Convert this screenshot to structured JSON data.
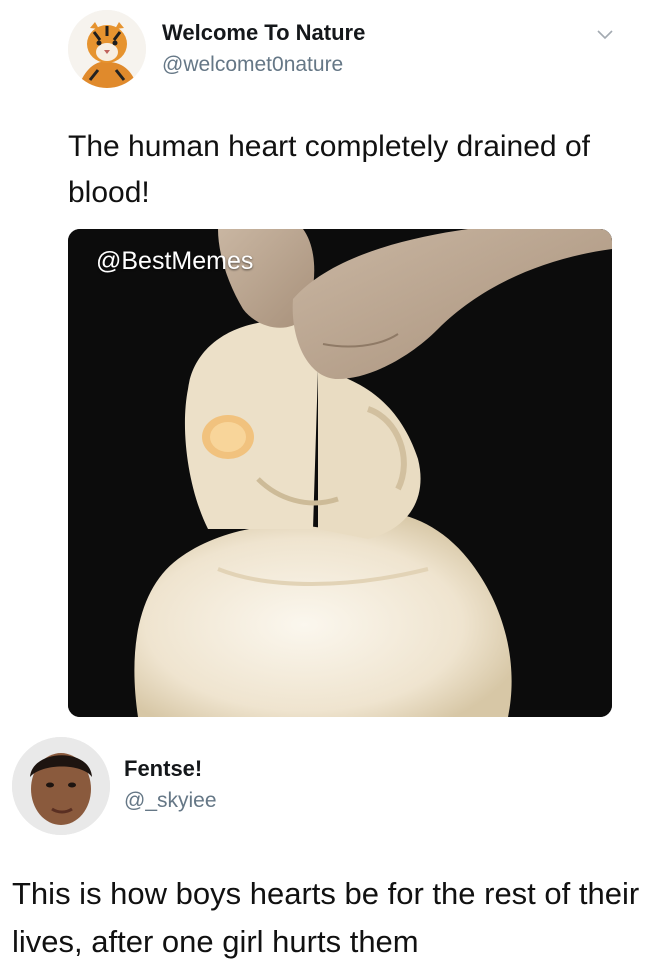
{
  "tweet1": {
    "display_name": "Welcome To Nature",
    "handle": "@welcomet0nature",
    "text": "The human heart completely drained of blood!",
    "avatar_icon": "tiger-avatar",
    "menu_icon": "chevron-down-icon",
    "image": {
      "watermark": "@BestMemes",
      "subject": "pale heart held by gloved fingers on black background"
    }
  },
  "tweet2": {
    "display_name": "Fentse!",
    "handle": "@_skyiee",
    "text": "This is how boys hearts be for the rest of their lives, after one girl hurts them",
    "avatar_icon": "person-avatar"
  },
  "colors": {
    "handle": "#657786",
    "name": "#14171a",
    "photo_bg": "#0c0c0c"
  }
}
